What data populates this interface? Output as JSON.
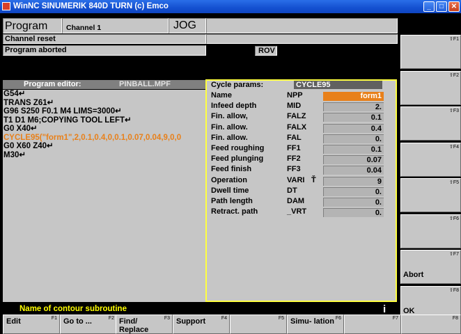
{
  "window": {
    "title": "WinNC SINUMERIK 840D TURN (c) Emco",
    "minimize": "_",
    "maximize": "□",
    "close": "✕"
  },
  "header": {
    "area": "Program",
    "channel": "Channel 1",
    "mode": "JOG",
    "channel_status": "Channel reset",
    "program_status": "Program aborted",
    "rov": "ROV"
  },
  "editor": {
    "title": "Program editor:",
    "filename": "PINBALL.MPF",
    "lines": [
      "G54↵",
      "TRANS Z61↵",
      "G96 S250 F0.1 M4 LIMS=3000↵",
      "T1 D1 M6;COPYING TOOL LEFT↵",
      "G0 X40↵",
      "CYCLE95(\"form1\",2,0.1,0.4,0,0.1,0.07,0.04,9,0,0",
      "G0 X60 Z40↵",
      "M30↵"
    ],
    "highlight_index": 5
  },
  "cycle": {
    "title": "Cycle params:",
    "name": "CYCLE95",
    "params": [
      {
        "label": "Name",
        "var": "NPP",
        "value": "form1"
      },
      {
        "label": "Infeed depth",
        "var": "MID",
        "value": "2."
      },
      {
        "label": "Fin. allow,",
        "var": "FALZ",
        "value": "0.1"
      },
      {
        "label": "Fin. allow.",
        "var": "FALX",
        "value": "0.4"
      },
      {
        "label": "Fin. allow.",
        "var": "FAL",
        "value": "0."
      },
      {
        "label": "Feed roughing",
        "var": "FF1",
        "value": "0.1"
      },
      {
        "label": "Feed plunging",
        "var": "FF2",
        "value": "0.07"
      },
      {
        "label": "Feed finish",
        "var": "FF3",
        "value": "0.04"
      },
      {
        "label": "Operation",
        "var": "VARI",
        "value": "9"
      },
      {
        "label": "Dwell time",
        "var": "DT",
        "value": "0."
      },
      {
        "label": "Path length",
        "var": "DAM",
        "value": "0."
      },
      {
        "label": "Retract. path",
        "var": "_VRT",
        "value": "0."
      }
    ],
    "toggle_mark": "Ť"
  },
  "message": {
    "text": "Name of contour subroutine",
    "info": "i"
  },
  "vertical_softkeys": [
    {
      "fkey": "⇧F1",
      "label": ""
    },
    {
      "fkey": "⇧F2",
      "label": ""
    },
    {
      "fkey": "⇧F3",
      "label": ""
    },
    {
      "fkey": "⇧F4",
      "label": ""
    },
    {
      "fkey": "⇧F5",
      "label": ""
    },
    {
      "fkey": "⇧F6",
      "label": ""
    },
    {
      "fkey": "⇧F7",
      "label": "Abort"
    },
    {
      "fkey": "⇧F8",
      "label": "OK"
    }
  ],
  "horizontal_softkeys": [
    {
      "fkey": "F1",
      "label": "Edit"
    },
    {
      "fkey": "F2",
      "label": "Go to ..."
    },
    {
      "fkey": "F3",
      "label": "Find/ Replace"
    },
    {
      "fkey": "F4",
      "label": "Support"
    },
    {
      "fkey": "F5",
      "label": ""
    },
    {
      "fkey": "F6",
      "label": "Simu- lation"
    },
    {
      "fkey": "F7",
      "label": ""
    },
    {
      "fkey": "F8",
      "label": ""
    }
  ],
  "colors": {
    "highlight_orange": "#e8801a",
    "message_yellow": "#ffff00",
    "panel_border": "#ffff40",
    "editor_title_bg": "#808080"
  }
}
